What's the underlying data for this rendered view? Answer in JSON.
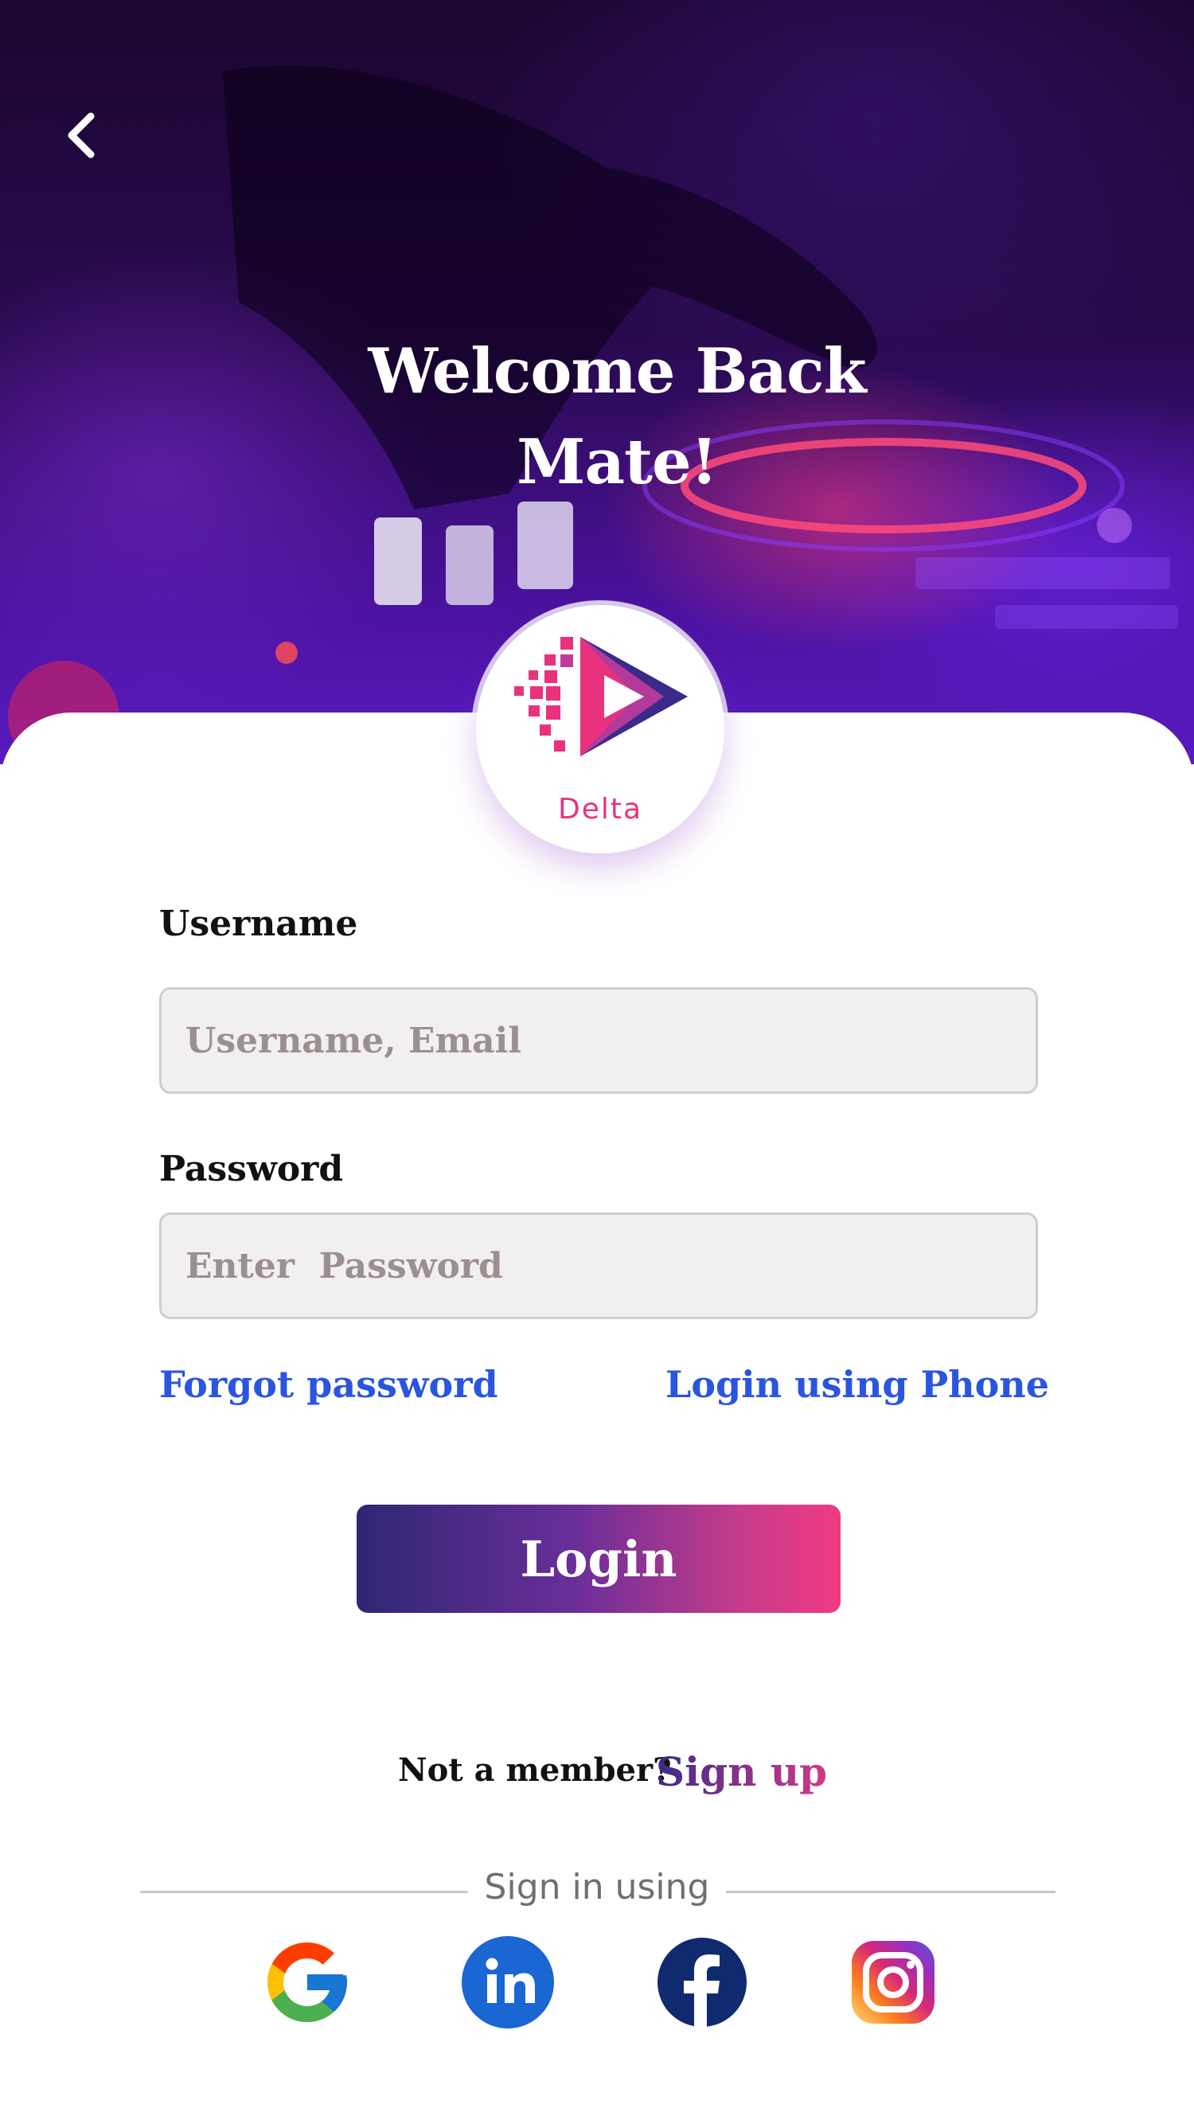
{
  "hero": {
    "title_line1": "Welcome Back",
    "title_line2": "Mate!",
    "back_icon": "chevron-left-icon"
  },
  "logo": {
    "brand": "Delta",
    "colors": {
      "pink": "#e8327e",
      "purple": "#3a2a8a",
      "magenta": "#b33a9a"
    }
  },
  "form": {
    "username_label": "Username",
    "username_placeholder": "Username, Email",
    "password_label": "Password",
    "password_placeholder": "Enter  Password",
    "forgot_password": "Forgot password",
    "login_phone": "Login using Phone",
    "login_button": "Login"
  },
  "signup": {
    "prompt": "Not a member?",
    "link": "Sign up"
  },
  "social": {
    "label": "Sign in using",
    "providers": [
      "google-icon",
      "linkedin-icon",
      "facebook-icon",
      "instagram-icon"
    ]
  },
  "colors": {
    "link": "#2a55e0",
    "button_start": "#2e2773",
    "button_end": "#f03a82",
    "input_bg": "#f2eff0"
  }
}
